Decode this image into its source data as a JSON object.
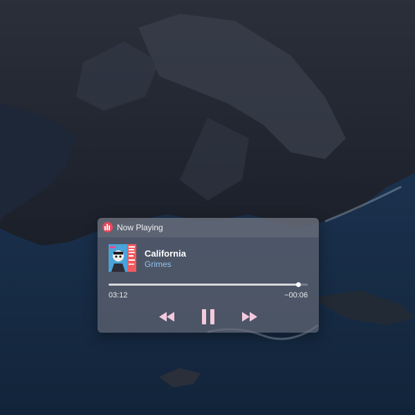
{
  "widget": {
    "title": "Now Playing",
    "app_icon": "music-app-icon"
  },
  "track": {
    "title": "California",
    "artist": "Grimes",
    "artwork_icon": "album-artwork"
  },
  "playback": {
    "elapsed": "03:12",
    "remaining": "−00:06",
    "progress": 0.95,
    "state": "playing"
  },
  "controls": {
    "rewind_icon": "rewind-icon",
    "pause_icon": "pause-icon",
    "forward_icon": "fast-forward-icon"
  },
  "colors": {
    "app_icon": "#e8485a",
    "artist_text": "#8fc3ee",
    "controls": "#f3c9dd"
  }
}
